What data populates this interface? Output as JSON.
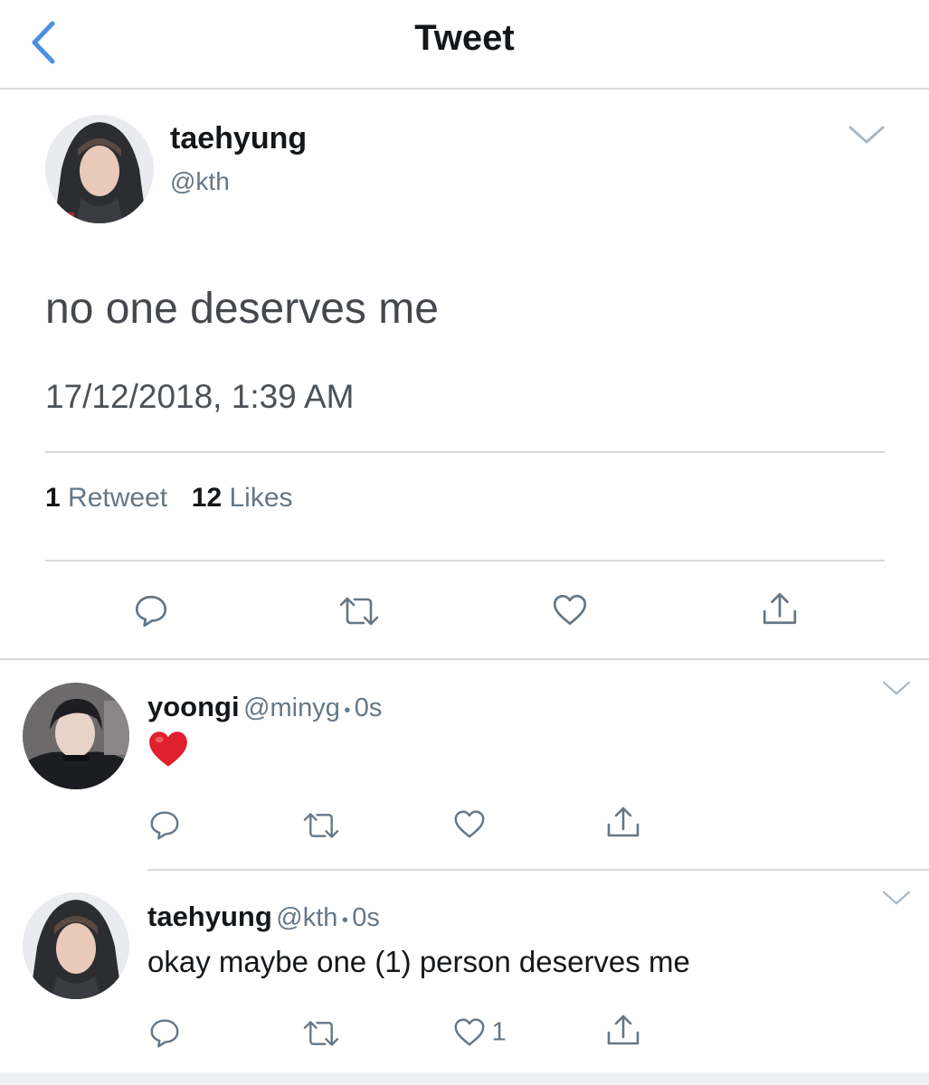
{
  "header": {
    "title": "Tweet"
  },
  "tweet": {
    "name": "taehyung",
    "handle": "@kth",
    "text": "no one deserves me",
    "timestamp": "17/12/2018, 1:39 AM",
    "retweets": {
      "count": "1",
      "label": "Retweet"
    },
    "likes": {
      "count": "12",
      "label": "Likes"
    }
  },
  "replies": [
    {
      "name": "yoongi",
      "handle": "@minyg",
      "separator": "•",
      "time": "0s",
      "text": "❤️",
      "like_count": ""
    },
    {
      "name": "taehyung",
      "handle": "@kth",
      "separator": "•",
      "time": "0s",
      "text": "okay maybe one (1) person deserves me",
      "like_count": "1"
    }
  ],
  "icons": {
    "back": "chevron-left-icon",
    "caret": "chevron-down-icon",
    "reply": "reply-icon",
    "retweet": "retweet-icon",
    "like": "heart-icon",
    "share": "share-icon"
  },
  "colors": {
    "accent": "#4a90e2",
    "icon_gray": "#657786",
    "heart_red": "#e0245e",
    "divider": "#d6d9dc"
  }
}
